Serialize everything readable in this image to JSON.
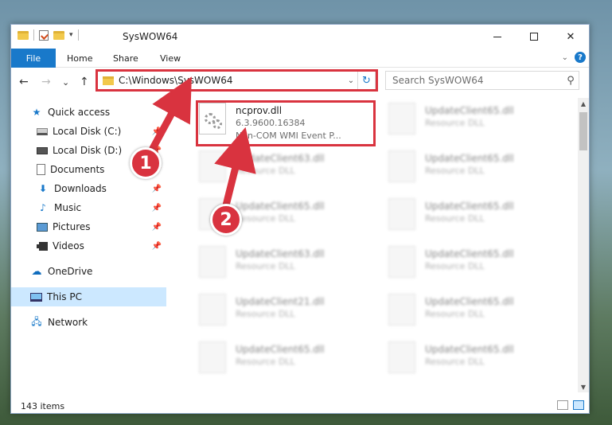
{
  "window": {
    "title": "SysWOW64",
    "controls": {
      "minimize": "",
      "maximize": "",
      "close": "✕"
    }
  },
  "ribbon": {
    "file": "File",
    "home": "Home",
    "share": "Share",
    "view": "View",
    "help": "?"
  },
  "nav": {
    "back": "←",
    "forward": "→",
    "recent": "⌄",
    "up": "↑",
    "address": "C:\\Windows\\SysWOW64",
    "refresh": "↻",
    "search_placeholder": "Search SysWOW64"
  },
  "sidebar": {
    "items": [
      {
        "label": "Quick access",
        "icon": "star-icon"
      },
      {
        "label": "Local Disk (C:)",
        "icon": "drive-icon",
        "pinned": true
      },
      {
        "label": "Local Disk (D:)",
        "icon": "drive-icon",
        "pinned": true
      },
      {
        "label": "Documents",
        "icon": "documents-icon",
        "pinned": true
      },
      {
        "label": "Downloads",
        "icon": "download-icon",
        "pinned": true
      },
      {
        "label": "Music",
        "icon": "music-icon",
        "pinned": true
      },
      {
        "label": "Pictures",
        "icon": "pictures-icon",
        "pinned": true
      },
      {
        "label": "Videos",
        "icon": "videos-icon",
        "pinned": true
      },
      {
        "label": "OneDrive",
        "icon": "cloud-icon"
      },
      {
        "label": "This PC",
        "icon": "computer-icon",
        "selected": true
      },
      {
        "label": "Network",
        "icon": "network-icon"
      }
    ]
  },
  "files": {
    "highlighted": {
      "name": "ncprov.dll",
      "version": "6.3.9600.16384",
      "desc": "Non-COM WMI Event P..."
    },
    "others": [
      {
        "name": "UpdateClient65.dll",
        "desc": "Resource DLL"
      },
      {
        "name": "UpdateClient63.dll",
        "desc": "Resource DLL"
      },
      {
        "name": "UpdateClient65.dll",
        "desc": "Resource DLL"
      },
      {
        "name": "UpdateClient65.dll",
        "desc": "Resource DLL"
      },
      {
        "name": "UpdateClient65.dll",
        "desc": "Resource DLL"
      },
      {
        "name": "UpdateClient63.dll",
        "desc": "Resource DLL"
      },
      {
        "name": "UpdateClient65.dll",
        "desc": "Resource DLL"
      },
      {
        "name": "UpdateClient21.dll",
        "desc": "Resource DLL"
      },
      {
        "name": "UpdateClient65.dll",
        "desc": "Resource DLL"
      },
      {
        "name": "UpdateClient65.dll",
        "desc": "Resource DLL"
      },
      {
        "name": "UpdateClient65.dll",
        "desc": "Resource DLL"
      }
    ]
  },
  "status": {
    "count": "143 items"
  },
  "annotations": {
    "badge1": "1",
    "badge2": "2",
    "color": "#d9333f"
  }
}
